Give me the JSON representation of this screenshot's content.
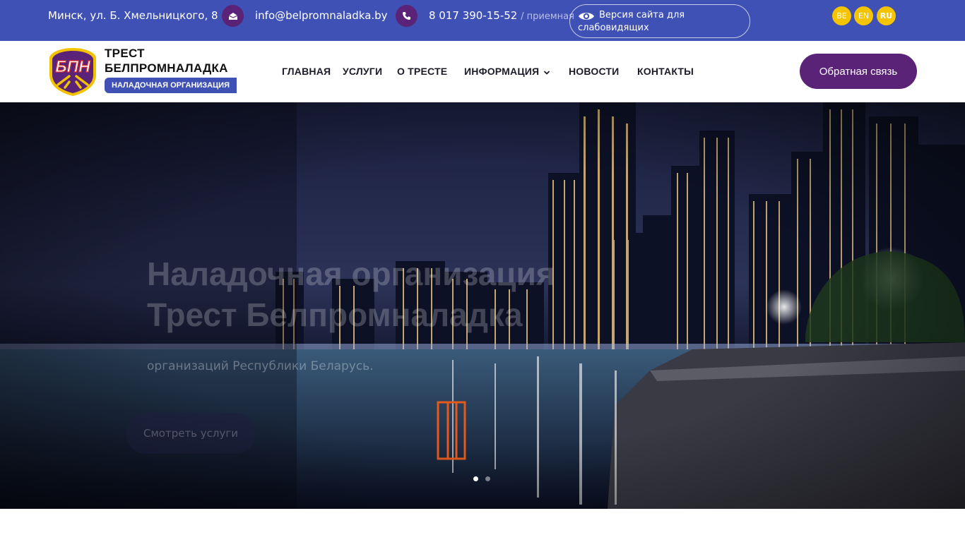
{
  "topbar": {
    "address": "Минск, ул. Б. Хмельницкого, 8",
    "email": "info@belpromnaladka.by",
    "phone": "8 017 390-15-52",
    "phone_note": "/ приемная",
    "vision_label": "Версия сайта для слабовидящих",
    "languages": [
      "BE",
      "EN",
      "RU"
    ],
    "active_language": "RU"
  },
  "header": {
    "brand_line1": "ТРЕСТ",
    "brand_line2": "БЕЛПРОМНАЛАДКА",
    "brand_tag": "НАЛАДОЧНАЯ ОРГАНИЗАЦИЯ",
    "logo_letters": "БПН",
    "nav": [
      "ГЛАВНАЯ",
      "УСЛУГИ",
      "О ТРЕСТЕ",
      "ИНФОРМАЦИЯ",
      "НОВОСТИ",
      "КОНТАКТЫ"
    ],
    "feedback_label": "Обратная связь"
  },
  "hero": {
    "title_line1": "Наладочная организация",
    "title_line2": "Трест Белпромналадка",
    "subtitle": "организаций Республики Беларусь.",
    "cta_label": "Смотреть услуги",
    "slides_count": 2,
    "active_slide": 1
  },
  "colors": {
    "topbar_bg": "#3f51b5",
    "accent_purple": "#5a2378",
    "lang_yellow": "#f5c400"
  }
}
